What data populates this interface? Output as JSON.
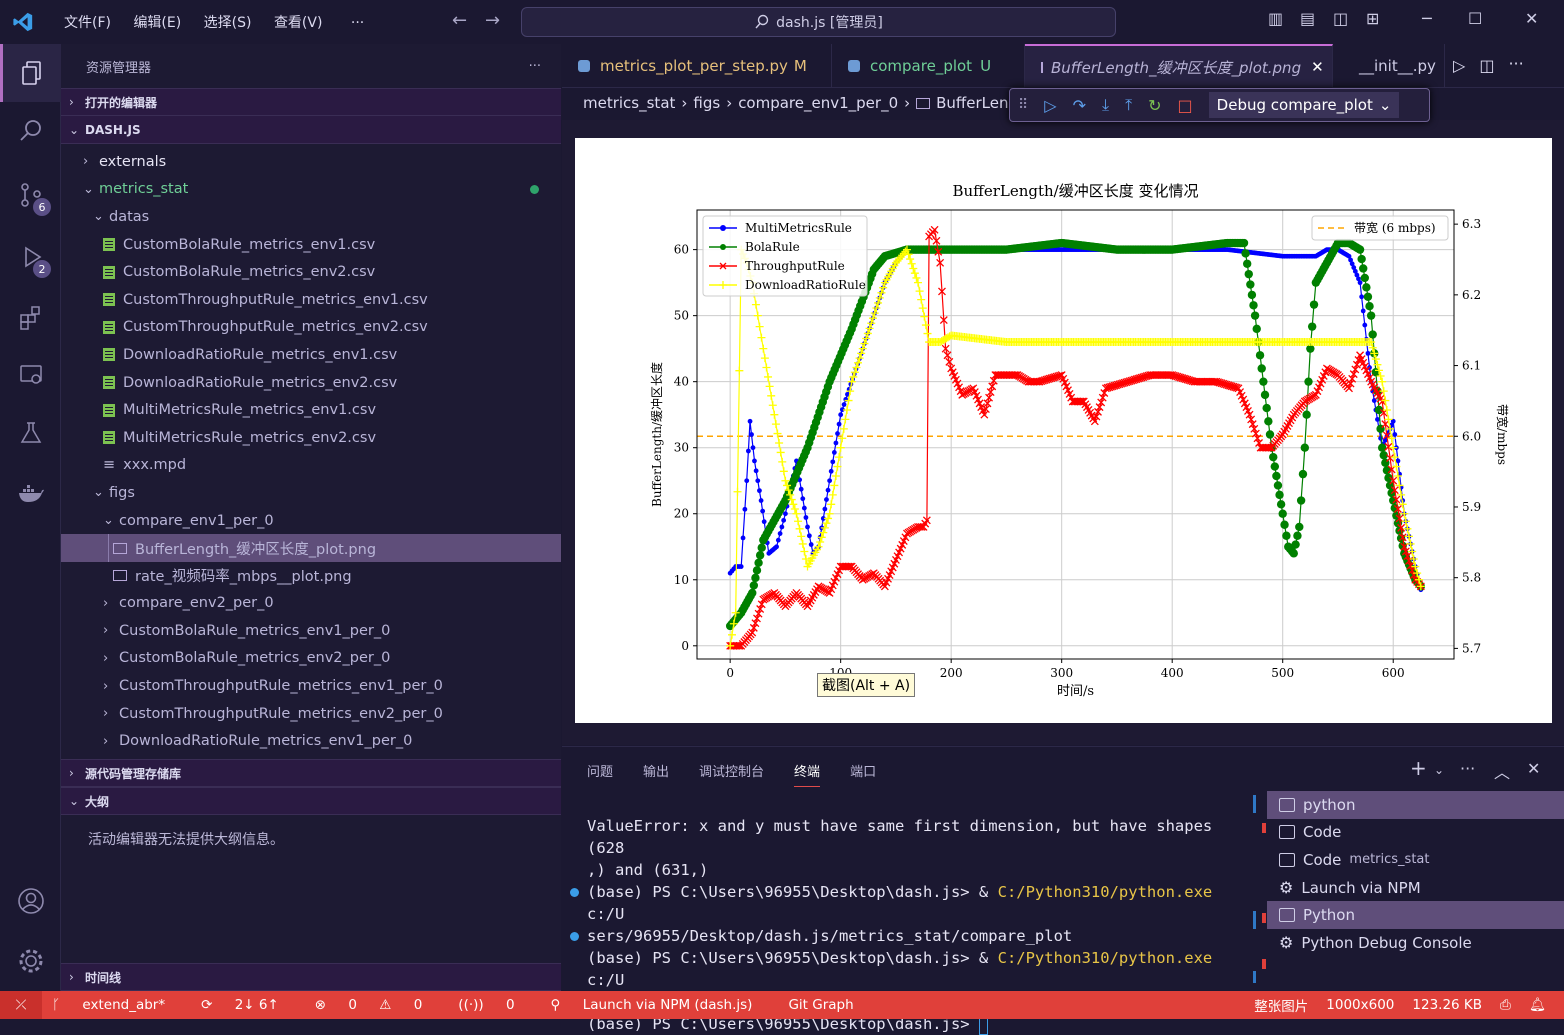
{
  "menu": [
    "文件(F)",
    "编辑(E)",
    "选择(S)",
    "查看(V)"
  ],
  "menu_more": "···",
  "search": {
    "text": "dash.js [管理员]"
  },
  "sidebar": {
    "title": "资源管理器",
    "more": "···",
    "sections": {
      "open_editors": "打开的编辑器",
      "project": "DASH.JS",
      "scm": "源代码管理存储库",
      "outline": "大纲",
      "timeline": "时间线"
    },
    "outline_message": "活动编辑器无法提供大纲信息。",
    "tree": [
      {
        "label": "externals",
        "type": "folder",
        "open": false,
        "level": 0
      },
      {
        "label": "metrics_stat",
        "type": "folder",
        "open": true,
        "level": 0,
        "modified": true
      },
      {
        "label": "datas",
        "type": "folder",
        "open": true,
        "level": 1
      },
      {
        "label": "CustomBolaRule_metrics_env1.csv",
        "type": "csv",
        "level": 2
      },
      {
        "label": "CustomBolaRule_metrics_env2.csv",
        "type": "csv",
        "level": 2
      },
      {
        "label": "CustomThroughputRule_metrics_env1.csv",
        "type": "csv",
        "level": 2
      },
      {
        "label": "CustomThroughputRule_metrics_env2.csv",
        "type": "csv",
        "level": 2
      },
      {
        "label": "DownloadRatioRule_metrics_env1.csv",
        "type": "csv",
        "level": 2
      },
      {
        "label": "DownloadRatioRule_metrics_env2.csv",
        "type": "csv",
        "level": 2
      },
      {
        "label": "MultiMetricsRule_metrics_env1.csv",
        "type": "csv",
        "level": 2
      },
      {
        "label": "MultiMetricsRule_metrics_env2.csv",
        "type": "csv",
        "level": 2
      },
      {
        "label": "xxx.mpd",
        "type": "file",
        "level": 2
      },
      {
        "label": "figs",
        "type": "folder",
        "open": true,
        "level": 1
      },
      {
        "label": "compare_env1_per_0",
        "type": "folder",
        "open": true,
        "level": 2
      },
      {
        "label": "BufferLength_缓冲区长度_plot.png",
        "type": "img",
        "level": 3,
        "selected": true
      },
      {
        "label": "rate_视频码率_mbps__plot.png",
        "type": "img",
        "level": 3
      },
      {
        "label": "compare_env2_per_0",
        "type": "folder",
        "open": false,
        "level": 2
      },
      {
        "label": "CustomBolaRule_metrics_env1_per_0",
        "type": "folder",
        "open": false,
        "level": 2
      },
      {
        "label": "CustomBolaRule_metrics_env2_per_0",
        "type": "folder",
        "open": false,
        "level": 2
      },
      {
        "label": "CustomThroughputRule_metrics_env1_per_0",
        "type": "folder",
        "open": false,
        "level": 2
      },
      {
        "label": "CustomThroughputRule_metrics_env2_per_0",
        "type": "folder",
        "open": false,
        "level": 2
      },
      {
        "label": "DownloadRatioRule_metrics_env1_per_0",
        "type": "folder",
        "open": false,
        "level": 2
      }
    ]
  },
  "activity": {
    "scm_badge": "6",
    "debug_badge": "2"
  },
  "tabs": [
    {
      "label": "metrics_plot_per_step.py",
      "suffix": "M",
      "color": "#e6c07b"
    },
    {
      "label": "compare_plot",
      "suffix": "U",
      "color": "#6fcf97"
    },
    {
      "label": "BufferLength_缓冲区长度_plot.png",
      "suffix": "",
      "color": "#b8b3d6",
      "active": true
    },
    {
      "label": "__init__.py",
      "suffix": "",
      "color": "#dcdaf0"
    }
  ],
  "breadcrumb": [
    "metrics_stat",
    "figs",
    "compare_env1_per_0",
    "BufferLeng"
  ],
  "debug": {
    "config": "Debug compare_plot"
  },
  "tooltip": "截图(Alt + A)",
  "chart_data": {
    "type": "line",
    "title": "BufferLength/缓冲区长度 变化情况",
    "xlabel": "时间/s",
    "ylabel": "BufferLength/缓冲区长度",
    "y2label": "带宽/mbps",
    "xlim": [
      -30,
      655
    ],
    "ylim": [
      -2,
      66
    ],
    "y2lim": [
      5.685,
      6.32
    ],
    "xticks": [
      0,
      100,
      200,
      300,
      400,
      500,
      600
    ],
    "yticks": [
      0,
      10,
      20,
      30,
      40,
      50,
      60
    ],
    "y2ticks": [
      5.7,
      5.8,
      5.9,
      6.0,
      6.1,
      6.2,
      6.3
    ],
    "grid": true,
    "legend_left": [
      "MultiMetricsRule",
      "BolaRule",
      "ThroughputRule",
      "DownloadRatioRule"
    ],
    "legend_right": "带宽 (6 mbps)",
    "bandwidth": 6.0,
    "series": [
      {
        "name": "MultiMetricsRule",
        "color": "#0000ff",
        "marker": "dot",
        "points": [
          [
            0,
            11
          ],
          [
            5,
            12
          ],
          [
            10,
            12
          ],
          [
            15,
            25
          ],
          [
            18,
            34
          ],
          [
            22,
            28
          ],
          [
            28,
            22
          ],
          [
            35,
            14
          ],
          [
            42,
            15
          ],
          [
            50,
            20
          ],
          [
            60,
            28
          ],
          [
            70,
            18
          ],
          [
            75,
            14
          ],
          [
            80,
            15
          ],
          [
            90,
            25
          ],
          [
            100,
            35
          ],
          [
            120,
            45
          ],
          [
            140,
            55
          ],
          [
            150,
            58
          ],
          [
            160,
            60
          ],
          [
            180,
            60
          ],
          [
            200,
            60
          ],
          [
            250,
            60
          ],
          [
            300,
            60
          ],
          [
            350,
            60
          ],
          [
            400,
            60
          ],
          [
            450,
            60
          ],
          [
            500,
            59
          ],
          [
            520,
            59
          ],
          [
            530,
            59
          ],
          [
            540,
            60
          ],
          [
            550,
            60
          ],
          [
            560,
            59
          ],
          [
            570,
            55
          ],
          [
            580,
            40
          ],
          [
            590,
            30
          ],
          [
            600,
            34
          ],
          [
            610,
            20
          ],
          [
            620,
            12
          ],
          [
            625,
            8.5
          ]
        ]
      },
      {
        "name": "BolaRule",
        "color": "#008000",
        "marker": "dot",
        "points": [
          [
            0,
            3
          ],
          [
            10,
            5
          ],
          [
            20,
            8
          ],
          [
            30,
            16
          ],
          [
            50,
            22
          ],
          [
            70,
            30
          ],
          [
            90,
            40
          ],
          [
            110,
            48
          ],
          [
            130,
            57
          ],
          [
            140,
            59
          ],
          [
            160,
            60
          ],
          [
            200,
            60
          ],
          [
            250,
            60
          ],
          [
            300,
            61
          ],
          [
            350,
            60
          ],
          [
            400,
            60
          ],
          [
            450,
            61
          ],
          [
            465,
            61
          ],
          [
            475,
            50
          ],
          [
            490,
            30
          ],
          [
            500,
            20
          ],
          [
            505,
            15
          ],
          [
            510,
            14
          ],
          [
            515,
            18
          ],
          [
            520,
            30
          ],
          [
            525,
            45
          ],
          [
            530,
            55
          ],
          [
            540,
            58
          ],
          [
            550,
            61
          ],
          [
            560,
            61
          ],
          [
            570,
            60
          ],
          [
            580,
            50
          ],
          [
            590,
            30
          ],
          [
            600,
            22
          ],
          [
            610,
            14
          ],
          [
            620,
            10
          ],
          [
            625,
            9
          ]
        ]
      },
      {
        "name": "ThroughputRule",
        "color": "#ff0000",
        "marker": "x",
        "points": [
          [
            0,
            0
          ],
          [
            10,
            0
          ],
          [
            20,
            2
          ],
          [
            30,
            7
          ],
          [
            40,
            8
          ],
          [
            50,
            6
          ],
          [
            60,
            8
          ],
          [
            70,
            6
          ],
          [
            80,
            9
          ],
          [
            90,
            8
          ],
          [
            100,
            12
          ],
          [
            110,
            12
          ],
          [
            120,
            10
          ],
          [
            130,
            11
          ],
          [
            140,
            9
          ],
          [
            150,
            13
          ],
          [
            160,
            17
          ],
          [
            170,
            18
          ],
          [
            175,
            18
          ],
          [
            178,
            19
          ],
          [
            180,
            62
          ],
          [
            185,
            63
          ],
          [
            190,
            58
          ],
          [
            195,
            45
          ],
          [
            200,
            42
          ],
          [
            210,
            38
          ],
          [
            220,
            39
          ],
          [
            230,
            35
          ],
          [
            240,
            41
          ],
          [
            250,
            41
          ],
          [
            260,
            41
          ],
          [
            270,
            40
          ],
          [
            280,
            40
          ],
          [
            300,
            41
          ],
          [
            310,
            37
          ],
          [
            320,
            37
          ],
          [
            330,
            34
          ],
          [
            340,
            39
          ],
          [
            360,
            40
          ],
          [
            380,
            41
          ],
          [
            400,
            41
          ],
          [
            420,
            40
          ],
          [
            440,
            40
          ],
          [
            460,
            39
          ],
          [
            470,
            35
          ],
          [
            480,
            30
          ],
          [
            490,
            30
          ],
          [
            500,
            32
          ],
          [
            510,
            35
          ],
          [
            520,
            37
          ],
          [
            530,
            38
          ],
          [
            540,
            42
          ],
          [
            550,
            41
          ],
          [
            560,
            39
          ],
          [
            570,
            44
          ],
          [
            580,
            40
          ],
          [
            590,
            37
          ],
          [
            600,
            25
          ],
          [
            610,
            15
          ],
          [
            620,
            10
          ],
          [
            625,
            9
          ]
        ]
      },
      {
        "name": "DownloadRatioRule",
        "color": "#ffff00",
        "marker": "plus",
        "points": [
          [
            0,
            0
          ],
          [
            5,
            5
          ],
          [
            10,
            60
          ],
          [
            15,
            58
          ],
          [
            20,
            55
          ],
          [
            25,
            50
          ],
          [
            30,
            45
          ],
          [
            40,
            35
          ],
          [
            50,
            25
          ],
          [
            60,
            20
          ],
          [
            70,
            12
          ],
          [
            80,
            15
          ],
          [
            90,
            20
          ],
          [
            100,
            30
          ],
          [
            110,
            40
          ],
          [
            120,
            45
          ],
          [
            140,
            55
          ],
          [
            150,
            58
          ],
          [
            160,
            60
          ],
          [
            170,
            55
          ],
          [
            180,
            46
          ],
          [
            190,
            46
          ],
          [
            200,
            47
          ],
          [
            250,
            46
          ],
          [
            300,
            46
          ],
          [
            350,
            46
          ],
          [
            400,
            46
          ],
          [
            450,
            46
          ],
          [
            500,
            46
          ],
          [
            550,
            46
          ],
          [
            580,
            46
          ],
          [
            590,
            40
          ],
          [
            600,
            30
          ],
          [
            610,
            20
          ],
          [
            620,
            12
          ],
          [
            625,
            9
          ]
        ]
      }
    ]
  },
  "panel": {
    "tabs": [
      "问题",
      "输出",
      "调试控制台",
      "终端",
      "端口"
    ],
    "active_tab": 3,
    "terminal_lines": [
      {
        "text": "ValueError: x and y must have same first dimension, but have shapes (628",
        "dot": ""
      },
      {
        "text": ",) and (631,)",
        "dot": ""
      },
      {
        "pre": "(base) PS C:\\Users\\96955\\Desktop\\dash.js> & ",
        "hl": "C:/Python310/python.exe",
        "post": " c:/U",
        "dot": "blue"
      },
      {
        "text": "sers/96955/Desktop/dash.js/metrics_stat/compare_plot",
        "dot": "blue"
      },
      {
        "pre": "(base) PS C:\\Users\\96955\\Desktop\\dash.js> & ",
        "hl": "C:/Python310/python.exe",
        "post": " c:/U",
        "dot": ""
      },
      {
        "text": "sers/96955/Desktop/dash.js/metrics_stat/compare_plot",
        "dot": "hollow"
      },
      {
        "text": "(base) PS C:\\Users\\96955\\Desktop\\dash.js> ",
        "dot": "",
        "cursor": true
      }
    ],
    "terminals": [
      {
        "label": "python",
        "active": true
      },
      {
        "label": "Code",
        "sub": ""
      },
      {
        "label": "Code",
        "sub": "metrics_stat"
      },
      {
        "label": "Launch via NPM",
        "debug": true
      },
      {
        "label": "Python",
        "active": true
      },
      {
        "label": "Python Debug Console",
        "debug": true
      }
    ]
  },
  "status": {
    "branch": "extend_abr*",
    "sync": "2↓ 6↑",
    "errors": "0",
    "warnings": "0",
    "ports": "0",
    "launch": "Launch via NPM (dash.js)",
    "git_graph": "Git Graph",
    "view": "整张图片",
    "size": "1000x600",
    "filesize": "123.26 KB"
  }
}
